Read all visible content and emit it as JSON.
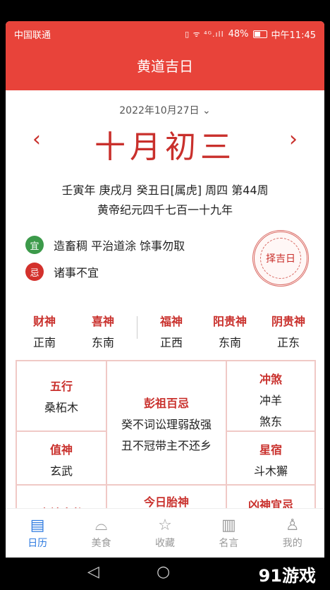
{
  "status_bar": {
    "carrier": "中国联通",
    "signal_icons": "▯ ᯤ ⁴ᴳ.ıll",
    "battery_pct": "48%",
    "time": "中午11:45"
  },
  "app_title": "黄道吉日",
  "date_select": {
    "label": "2022年10月27日",
    "chevron": "⌄"
  },
  "lunar_date": "十月初三",
  "nav": {
    "prev": "‹",
    "next": "›"
  },
  "info_line1": "壬寅年 庚戌月 癸丑日[属虎] 周四 第44周",
  "info_line2": "黄帝纪元四千七百一十九年",
  "yi": {
    "badge": "宜",
    "text": "造畜稠 平治道涂 馀事勿取"
  },
  "ji": {
    "badge": "忌",
    "text": "诸事不宜"
  },
  "zeji_stamp": "择吉日",
  "gods": [
    {
      "name": "财神",
      "dir": "正南"
    },
    {
      "name": "喜神",
      "dir": "东南"
    },
    {
      "name": "福神",
      "dir": "正西"
    },
    {
      "name": "阳贵神",
      "dir": "东南"
    },
    {
      "name": "阴贵神",
      "dir": "正东"
    }
  ],
  "grid": {
    "wuxing": {
      "title": "五行",
      "value": "桑柘木"
    },
    "pengzu": {
      "title": "彭祖百忌",
      "line1": "癸不词讼理弱敌强",
      "line2": "丑不冠带主不还乡"
    },
    "chongsha": {
      "title": "冲煞",
      "line1": "冲羊",
      "line2": "煞东"
    },
    "zhishen": {
      "title": "值神",
      "value": "玄武"
    },
    "xingxiu": {
      "title": "星宿",
      "value": "斗木獬"
    },
    "jishen": {
      "title": "吉神宜趋"
    },
    "taishen": {
      "title": "今日胎神"
    },
    "xiongshen": {
      "title": "凶神宜忌"
    }
  },
  "tabs": [
    {
      "label": "日历",
      "icon": "calendar-icon"
    },
    {
      "label": "美食",
      "icon": "food-icon"
    },
    {
      "label": "收藏",
      "icon": "star-icon"
    },
    {
      "label": "名言",
      "icon": "book-icon"
    },
    {
      "label": "我的",
      "icon": "user-icon"
    }
  ],
  "watermark": "91游戏",
  "colors": {
    "brand_red": "#e8433a",
    "yi_green": "#3c9a4a",
    "active_tab": "#2f7be0"
  }
}
